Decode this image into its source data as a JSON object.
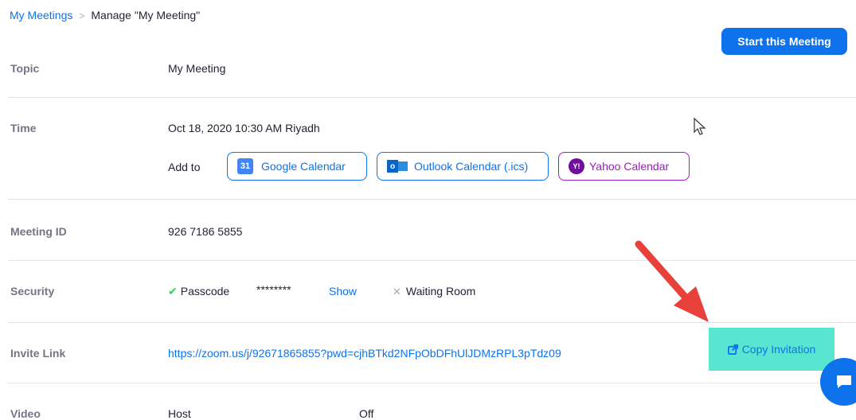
{
  "breadcrumb": {
    "parent": "My Meetings",
    "separator": ">",
    "current": "Manage \"My Meeting\""
  },
  "start_button": "Start this Meeting",
  "topic": {
    "label": "Topic",
    "value": "My Meeting"
  },
  "time": {
    "label": "Time",
    "value": "Oct 18, 2020 10:30 AM Riyadh",
    "add_to": "Add to",
    "calendars": [
      {
        "label": "Google Calendar",
        "icon": "google-calendar-icon",
        "icon_text": "31"
      },
      {
        "label": "Outlook Calendar (.ics)",
        "icon": "outlook-icon",
        "icon_text": "o"
      },
      {
        "label": "Yahoo Calendar",
        "icon": "yahoo-icon",
        "icon_text": "Y!"
      }
    ]
  },
  "meeting_id": {
    "label": "Meeting ID",
    "value": "926 7186 5855"
  },
  "security": {
    "label": "Security",
    "passcode_label": "Passcode",
    "passcode_value": "********",
    "show_label": "Show",
    "waiting_room_label": "Waiting Room"
  },
  "invite_link": {
    "label": "Invite Link",
    "url": "https://zoom.us/j/92671865855?pwd=cjhBTkd2NFpObDFhUlJDMzRPL3pTdz09",
    "copy_label": "Copy Invitation"
  },
  "video": {
    "label": "Video",
    "host_label": "Host",
    "host_value": "Off"
  },
  "colors": {
    "accent": "#0e72ed",
    "yahoo": "#a01ac7",
    "copy_highlight": "#58e6d0",
    "annotation_arrow": "#e8413c"
  }
}
